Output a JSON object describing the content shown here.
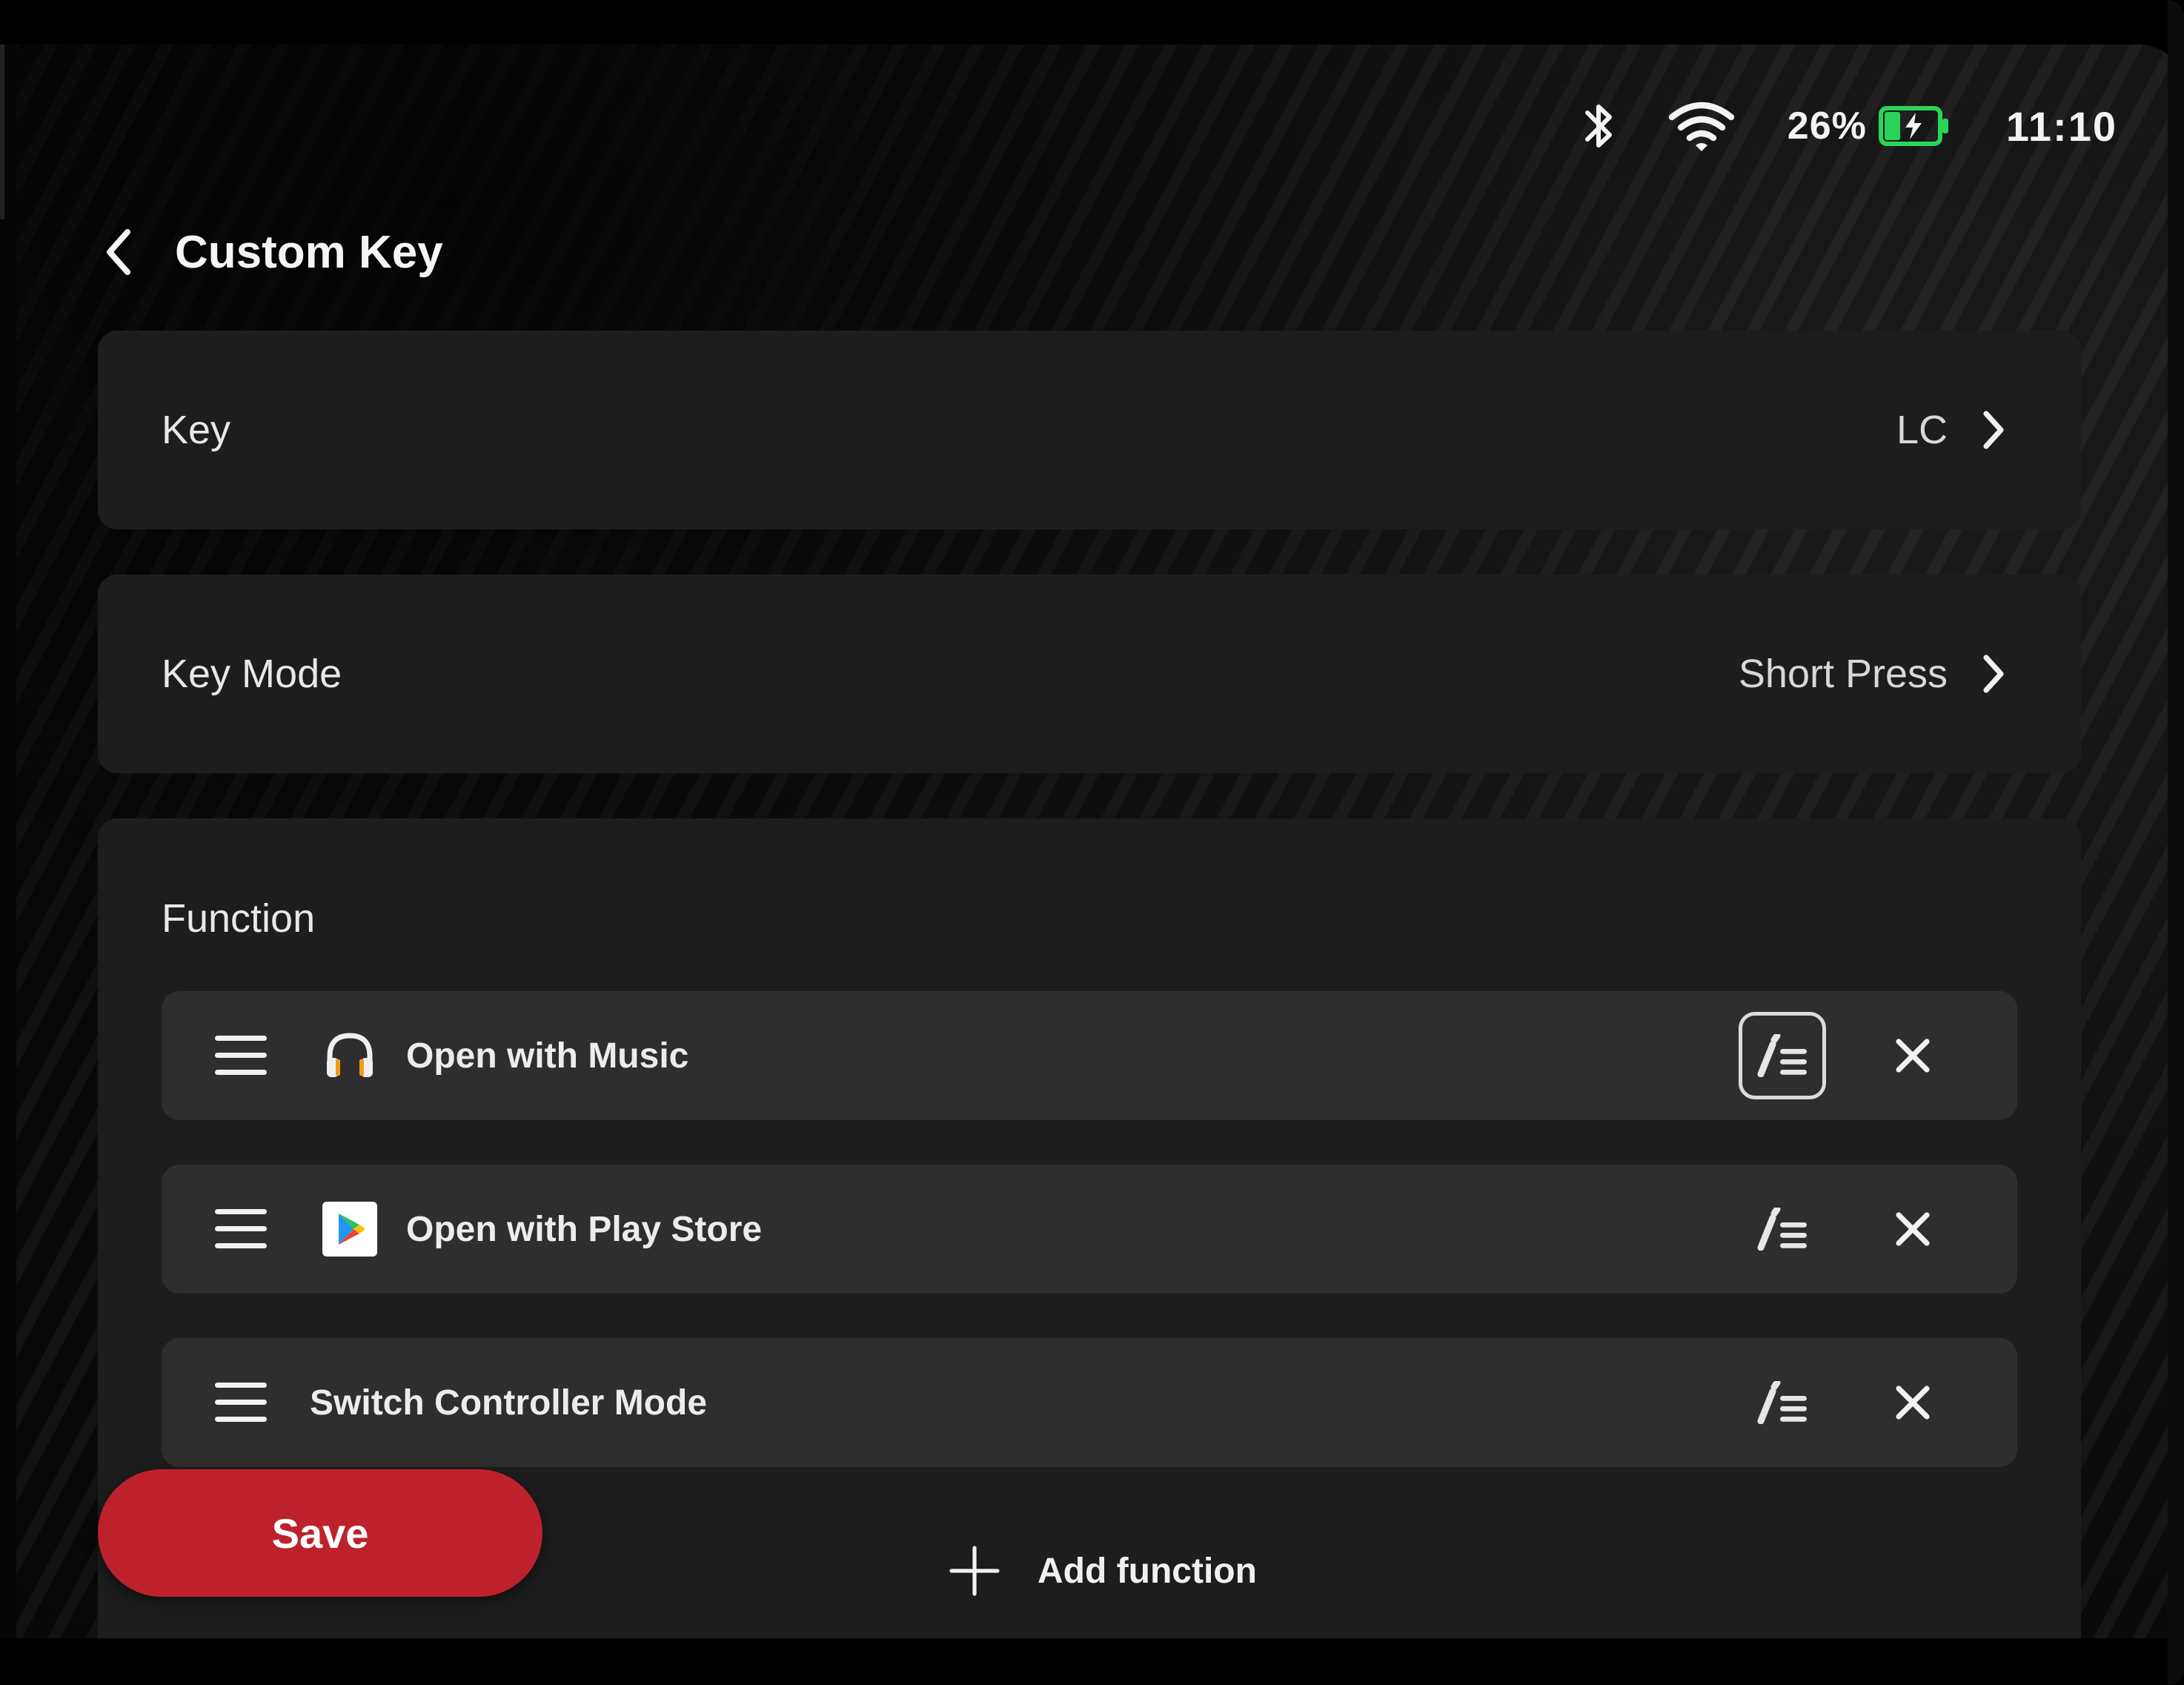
{
  "status_bar": {
    "bluetooth_icon": "bluetooth-icon",
    "wifi_icon": "wifi-icon",
    "battery_percent": "26%",
    "battery_level": 0.26,
    "battery_charging": true,
    "battery_color": "#2ad45a",
    "time": "11:10"
  },
  "header": {
    "back_icon": "chevron-left-icon",
    "title": "Custom Key"
  },
  "settings": {
    "key": {
      "label": "Key",
      "value": "LC"
    },
    "key_mode": {
      "label": "Key Mode",
      "value": "Short Press"
    }
  },
  "function_section": {
    "title": "Function",
    "items": [
      {
        "label": "Open with Music",
        "app_icon": "headphones-icon",
        "edit_selected": true
      },
      {
        "label": "Open with Play Store",
        "app_icon": "play-store-icon",
        "edit_selected": false
      },
      {
        "label": "Switch Controller Mode",
        "app_icon": "",
        "edit_selected": false
      }
    ],
    "add_label": "Add function"
  },
  "actions": {
    "save_label": "Save"
  },
  "colors": {
    "accent_red": "#bd222c",
    "card_bg": "#1d1d1d",
    "item_bg": "#2e2e2e"
  }
}
